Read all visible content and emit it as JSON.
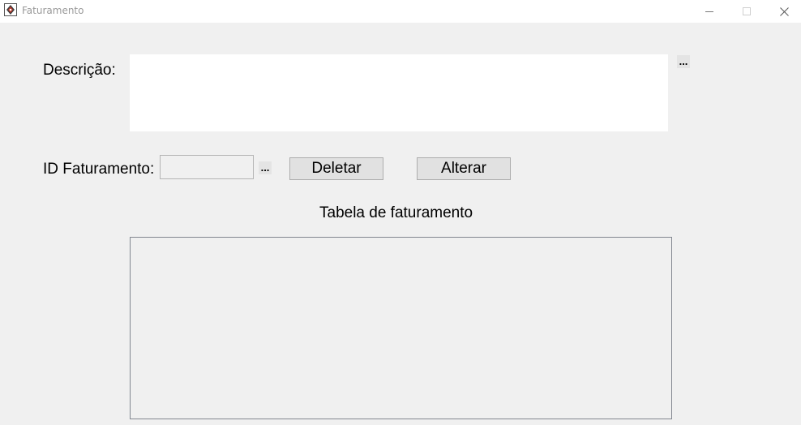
{
  "window": {
    "title": "Faturamento",
    "icons": {
      "app": "java-app-icon",
      "minimize": "minimize-icon",
      "maximize": "maximize-icon",
      "close": "close-icon"
    }
  },
  "form": {
    "descricao_label": "Descrição:",
    "descricao_value": "",
    "descricao_browse_label": "...",
    "id_label": "ID Faturamento:",
    "id_value": "",
    "id_browse_label": "...",
    "delete_label": "Deletar",
    "alter_label": "Alterar"
  },
  "table": {
    "title": "Tabela de faturamento",
    "rows": []
  }
}
